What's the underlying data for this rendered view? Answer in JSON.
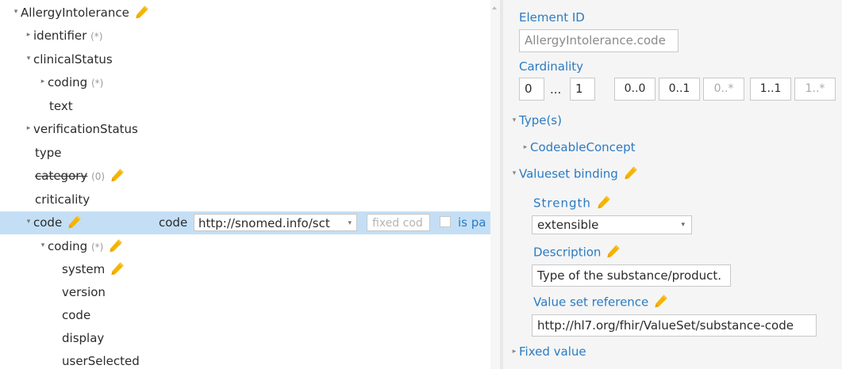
{
  "tree": {
    "rows": [
      {
        "label": "AllergyIntolerance",
        "toggle": "▾",
        "suffix": "",
        "edited": true,
        "strike": false
      },
      {
        "label": "identifier",
        "toggle": "▸",
        "suffix": "(*)",
        "edited": false,
        "strike": false
      },
      {
        "label": "clinicalStatus",
        "toggle": "▾",
        "suffix": "",
        "edited": false,
        "strike": false
      },
      {
        "label": "coding",
        "toggle": "▸",
        "suffix": "(*)",
        "edited": false,
        "strike": false
      },
      {
        "label": "text",
        "toggle": "",
        "suffix": "",
        "edited": false,
        "strike": false
      },
      {
        "label": "verificationStatus",
        "toggle": "▸",
        "suffix": "",
        "edited": false,
        "strike": false
      },
      {
        "label": "type",
        "toggle": "",
        "suffix": "",
        "edited": false,
        "strike": false
      },
      {
        "label": "category",
        "toggle": "",
        "suffix": "(0)",
        "edited": true,
        "strike": true
      },
      {
        "label": "criticality",
        "toggle": "",
        "suffix": "",
        "edited": false,
        "strike": false
      },
      {
        "label": "code",
        "toggle": "▾",
        "suffix": "",
        "edited": true,
        "strike": false,
        "selected": true
      },
      {
        "label": "coding",
        "toggle": "▾",
        "suffix": "(*)",
        "edited": true,
        "strike": false
      },
      {
        "label": "system",
        "toggle": "",
        "suffix": "",
        "edited": true,
        "strike": false
      },
      {
        "label": "version",
        "toggle": "",
        "suffix": "",
        "edited": false,
        "strike": false
      },
      {
        "label": "code",
        "toggle": "",
        "suffix": "",
        "edited": false,
        "strike": false
      },
      {
        "label": "display",
        "toggle": "",
        "suffix": "",
        "edited": false,
        "strike": false
      },
      {
        "label": "userSelected",
        "toggle": "",
        "suffix": "",
        "edited": false,
        "strike": false
      }
    ],
    "inline_editor": {
      "label": "code",
      "system_value": "http://snomed.info/sct",
      "fixed_placeholder": "fixed cod",
      "pattern_label": "is pa"
    }
  },
  "details": {
    "element_id_label": "Element ID",
    "element_id_value": "AllergyIntolerance.code",
    "cardinality_label": "Cardinality",
    "card_min": "0",
    "card_sep": "...",
    "card_max": "1",
    "card_buttons": [
      "0..0",
      "0..1",
      "0..*",
      "1..1",
      "1..*"
    ],
    "types_label": "Type(s)",
    "type_item": "CodeableConcept",
    "binding_label": "Valueset binding",
    "strength_label": "Strength",
    "strength_value": "extensible",
    "description_label": "Description",
    "description_value": "Type of the substance/product.",
    "valueset_label": "Value set reference",
    "valueset_value": "http://hl7.org/fhir/ValueSet/substance-code",
    "fixed_value_label": "Fixed value",
    "toggle_open": "▾",
    "toggle_closed": "▸",
    "select_caret": "▾"
  },
  "colors": {
    "accent": "#2b7bc4",
    "selection": "#c4dff5",
    "pencil": "#f5b400",
    "panel_bg": "#f5f5f5"
  },
  "icons": {
    "edit": "pencil-icon",
    "expand": "chevron-right-icon",
    "collapse": "chevron-down-icon"
  }
}
